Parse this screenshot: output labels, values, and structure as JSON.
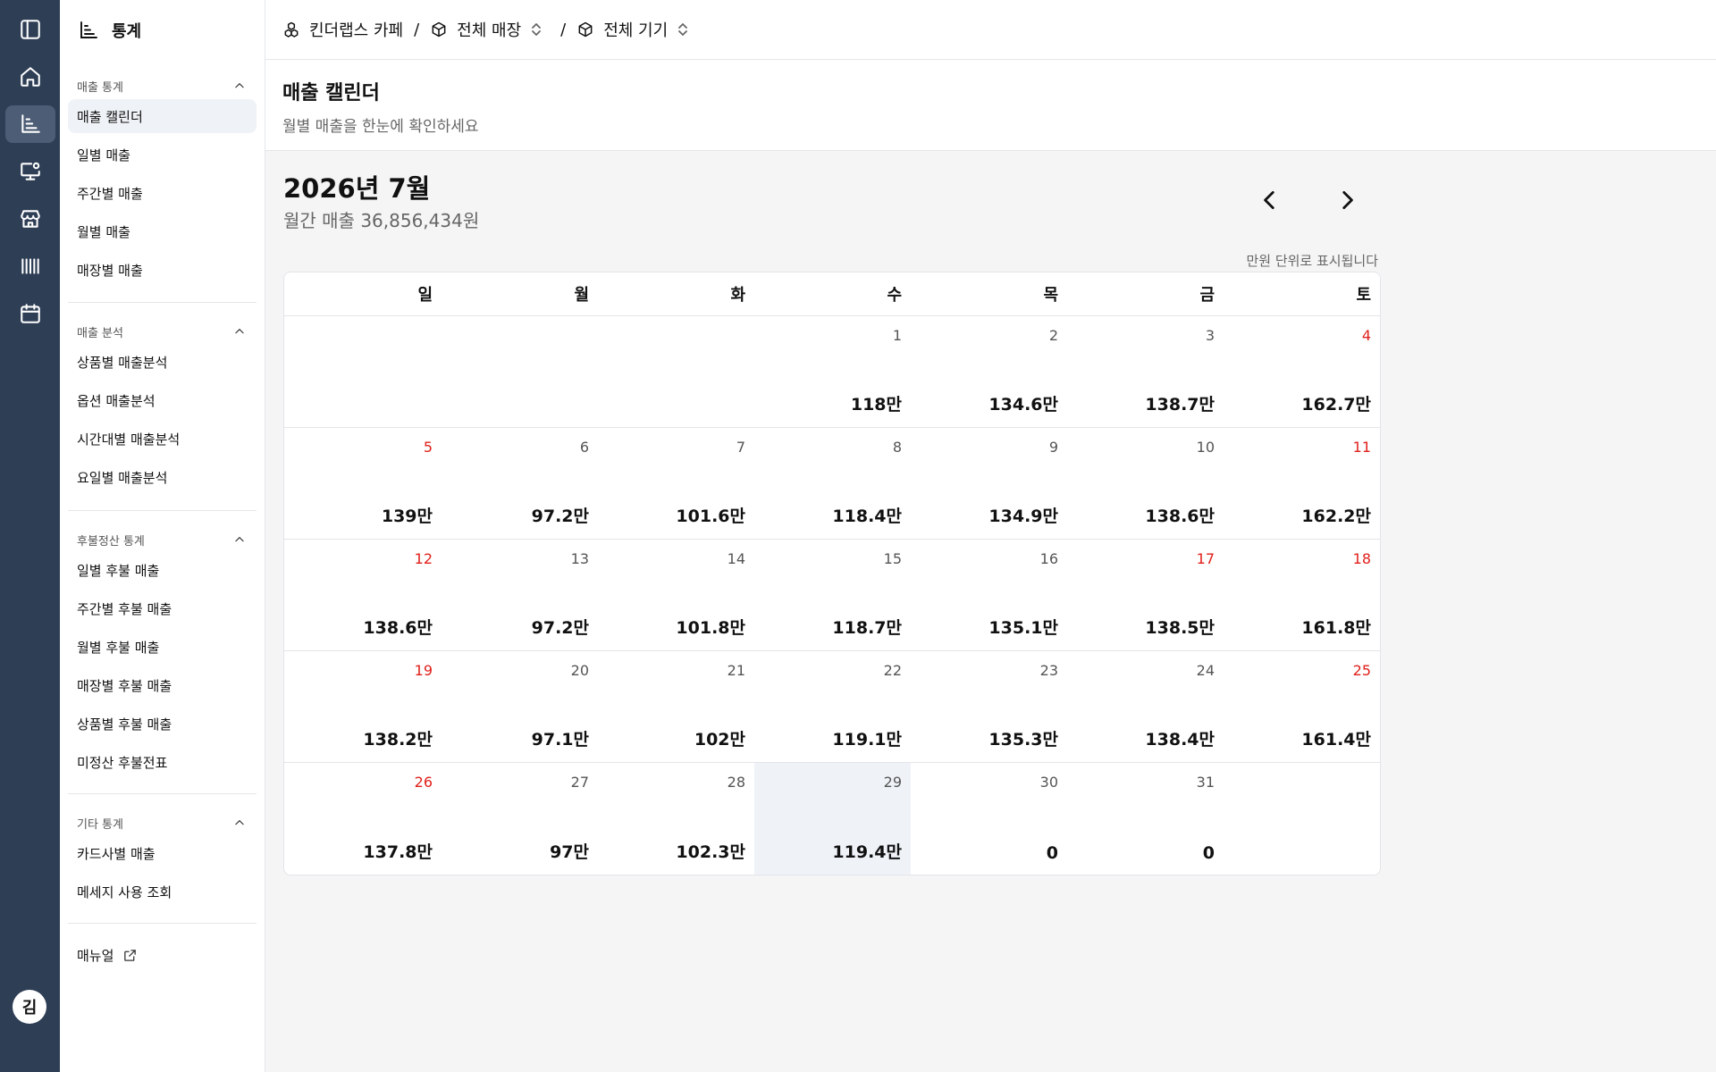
{
  "rail": {
    "avatar": "김"
  },
  "sidebar": {
    "title": "통계",
    "sections": [
      {
        "title": "매출 통계",
        "items": [
          "매출 캘린더",
          "일별 매출",
          "주간별 매출",
          "월별 매출",
          "매장별 매출"
        ]
      },
      {
        "title": "매출 분석",
        "items": [
          "상품별 매출분석",
          "옵션 매출분석",
          "시간대별 매출분석",
          "요일별 매출분석"
        ]
      },
      {
        "title": "후불정산 통계",
        "items": [
          "일별 후불 매출",
          "주간별 후불 매출",
          "월별 후불 매출",
          "매장별 후불 매출",
          "상품별 후불 매출",
          "미정산 후불전표"
        ]
      },
      {
        "title": "기타 통계",
        "items": [
          "카드사별 매출",
          "메세지 사용 조회"
        ]
      }
    ],
    "manual": "매뉴얼"
  },
  "topbar": {
    "brand": "킨더랩스 카페",
    "sep": "/",
    "store": "전체 매장",
    "device": "전체 기기"
  },
  "page": {
    "title": "매출 캘린더",
    "subtitle": "월별 매출을 한눈에 확인하세요"
  },
  "calendar": {
    "month_title": "2026년 7월",
    "month_total": "월간 매출 36,856,434원",
    "unit_note": "만원 단위로 표시됩니다",
    "weekdays": [
      "일",
      "월",
      "화",
      "수",
      "목",
      "금",
      "토"
    ],
    "weeks": [
      [
        {
          "d": "",
          "v": ""
        },
        {
          "d": "",
          "v": ""
        },
        {
          "d": "",
          "v": ""
        },
        {
          "d": "1",
          "v": "118만"
        },
        {
          "d": "2",
          "v": "134.6만"
        },
        {
          "d": "3",
          "v": "138.7만"
        },
        {
          "d": "4",
          "v": "162.7만",
          "red": true
        }
      ],
      [
        {
          "d": "5",
          "v": "139만",
          "red": true
        },
        {
          "d": "6",
          "v": "97.2만"
        },
        {
          "d": "7",
          "v": "101.6만"
        },
        {
          "d": "8",
          "v": "118.4만"
        },
        {
          "d": "9",
          "v": "134.9만"
        },
        {
          "d": "10",
          "v": "138.6만"
        },
        {
          "d": "11",
          "v": "162.2만",
          "red": true
        }
      ],
      [
        {
          "d": "12",
          "v": "138.6만",
          "red": true
        },
        {
          "d": "13",
          "v": "97.2만"
        },
        {
          "d": "14",
          "v": "101.8만"
        },
        {
          "d": "15",
          "v": "118.7만"
        },
        {
          "d": "16",
          "v": "135.1만"
        },
        {
          "d": "17",
          "v": "138.5만",
          "red": true
        },
        {
          "d": "18",
          "v": "161.8만",
          "red": true
        }
      ],
      [
        {
          "d": "19",
          "v": "138.2만",
          "red": true
        },
        {
          "d": "20",
          "v": "97.1만"
        },
        {
          "d": "21",
          "v": "102만"
        },
        {
          "d": "22",
          "v": "119.1만"
        },
        {
          "d": "23",
          "v": "135.3만"
        },
        {
          "d": "24",
          "v": "138.4만"
        },
        {
          "d": "25",
          "v": "161.4만",
          "red": true
        }
      ],
      [
        {
          "d": "26",
          "v": "137.8만",
          "red": true
        },
        {
          "d": "27",
          "v": "97만"
        },
        {
          "d": "28",
          "v": "102.3만"
        },
        {
          "d": "29",
          "v": "119.4만",
          "today": true
        },
        {
          "d": "30",
          "v": "0"
        },
        {
          "d": "31",
          "v": "0"
        },
        {
          "d": "",
          "v": ""
        }
      ]
    ]
  },
  "colors": {
    "rail": "#2e3e55",
    "holiday": "#e0201b",
    "today_bg": "#eff3f8"
  }
}
